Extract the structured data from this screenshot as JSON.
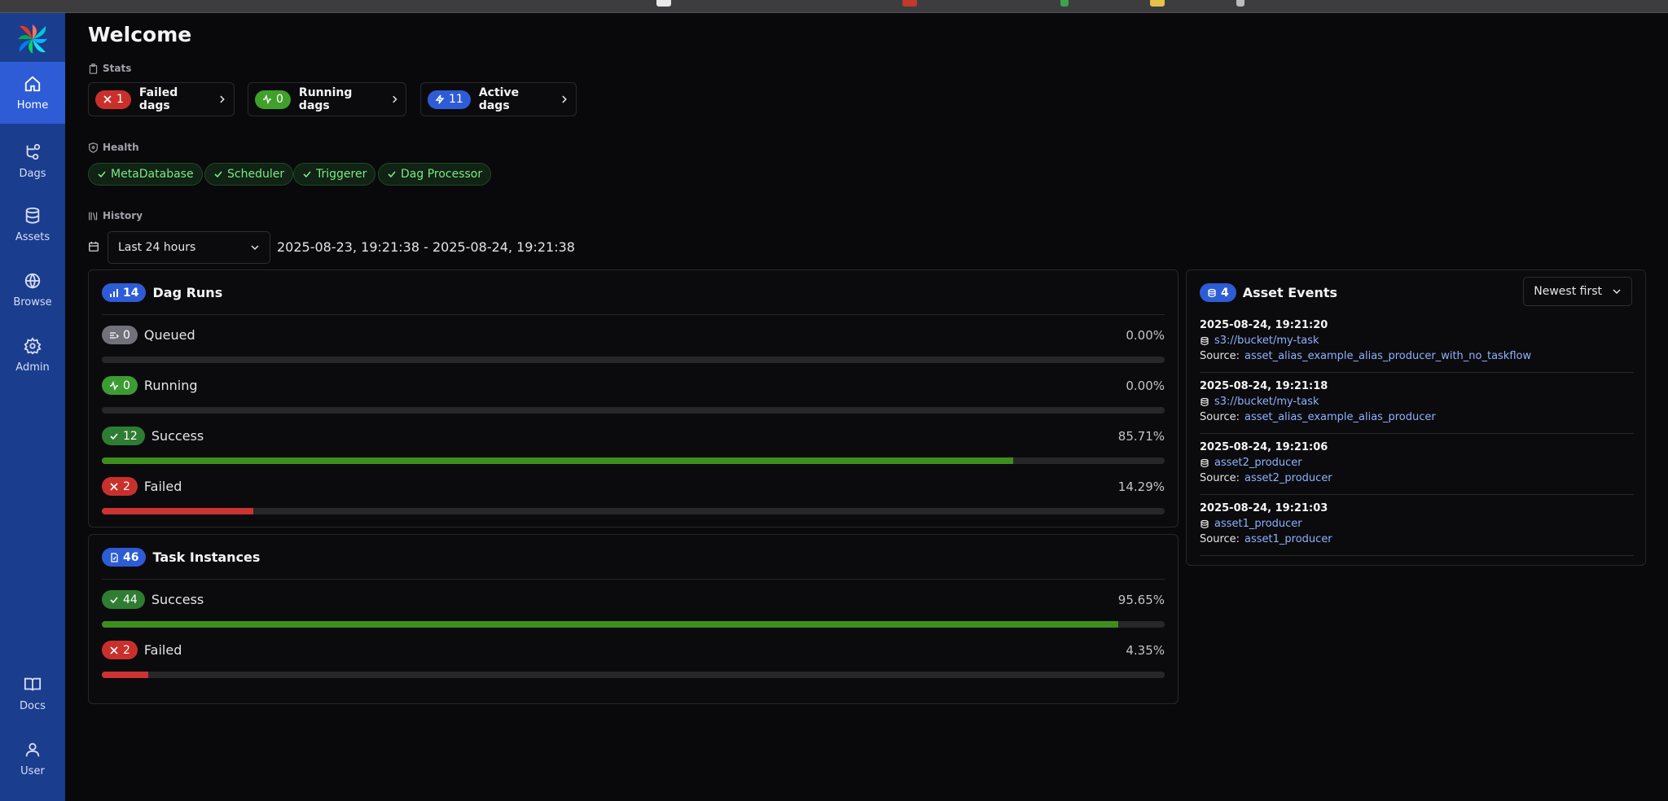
{
  "nav": {
    "home": "Home",
    "dags": "Dags",
    "assets": "Assets",
    "browse": "Browse",
    "admin": "Admin",
    "docs": "Docs",
    "user": "User"
  },
  "page_title": "Welcome",
  "stats": {
    "label": "Stats",
    "failed": {
      "count": "1",
      "label": "Failed dags"
    },
    "running": {
      "count": "0",
      "label": "Running dags"
    },
    "active": {
      "count": "11",
      "label": "Active dags"
    }
  },
  "health": {
    "label": "Health",
    "items": [
      "MetaDatabase",
      "Scheduler",
      "Triggerer",
      "Dag Processor"
    ]
  },
  "history": {
    "label": "History",
    "range_select": "Last 24 hours",
    "range_text": "2025-08-23, 19:21:38 - 2025-08-24, 19:21:38"
  },
  "dag_runs": {
    "count": "14",
    "title": "Dag Runs",
    "rows": [
      {
        "count": "0",
        "label": "Queued",
        "pct": "0.00%",
        "fraction": 0.0
      },
      {
        "count": "0",
        "label": "Running",
        "pct": "0.00%",
        "fraction": 0.0
      },
      {
        "count": "12",
        "label": "Success",
        "pct": "85.71%",
        "fraction": 0.8571
      },
      {
        "count": "2",
        "label": "Failed",
        "pct": "14.29%",
        "fraction": 0.1429
      }
    ]
  },
  "task_instances": {
    "count": "46",
    "title": "Task Instances",
    "rows": [
      {
        "count": "44",
        "label": "Success",
        "pct": "95.65%",
        "fraction": 0.9565
      },
      {
        "count": "2",
        "label": "Failed",
        "pct": "4.35%",
        "fraction": 0.0435
      }
    ]
  },
  "asset_events": {
    "count": "4",
    "title": "Asset Events",
    "sort": "Newest first",
    "source_label": "Source:",
    "events": [
      {
        "date": "2025-08-24, 19:21:20",
        "asset": "s3://bucket/my-task",
        "source": "asset_alias_example_alias_producer_with_no_taskflow"
      },
      {
        "date": "2025-08-24, 19:21:18",
        "asset": "s3://bucket/my-task",
        "source": "asset_alias_example_alias_producer"
      },
      {
        "date": "2025-08-24, 19:21:06",
        "asset": "asset2_producer",
        "source": "asset2_producer"
      },
      {
        "date": "2025-08-24, 19:21:03",
        "asset": "asset1_producer",
        "source": "asset1_producer"
      }
    ]
  },
  "colors": {
    "sidebar": "#1b3d8e",
    "sidebar_active": "#2d5cd6",
    "success": "#3e8e1e",
    "failed": "#cc3333",
    "link": "#8fb1ff"
  }
}
